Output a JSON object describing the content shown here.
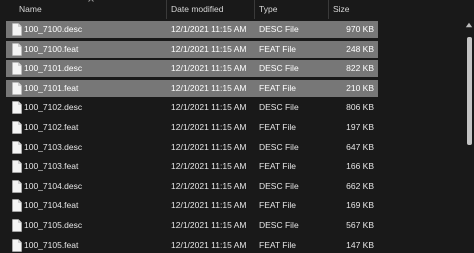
{
  "columns": {
    "name": "Name",
    "date": "Date modified",
    "type": "Type",
    "size": "Size"
  },
  "files": [
    {
      "name": "100_7100.desc",
      "date": "12/1/2021 11:15 AM",
      "type": "DESC File",
      "size": "970 KB",
      "selected": true
    },
    {
      "name": "100_7100.feat",
      "date": "12/1/2021 11:15 AM",
      "type": "FEAT File",
      "size": "248 KB",
      "selected": true
    },
    {
      "name": "100_7101.desc",
      "date": "12/1/2021 11:15 AM",
      "type": "DESC File",
      "size": "822 KB",
      "selected": true
    },
    {
      "name": "100_7101.feat",
      "date": "12/1/2021 11:15 AM",
      "type": "FEAT File",
      "size": "210 KB",
      "selected": true
    },
    {
      "name": "100_7102.desc",
      "date": "12/1/2021 11:15 AM",
      "type": "DESC File",
      "size": "806 KB",
      "selected": false
    },
    {
      "name": "100_7102.feat",
      "date": "12/1/2021 11:15 AM",
      "type": "FEAT File",
      "size": "197 KB",
      "selected": false
    },
    {
      "name": "100_7103.desc",
      "date": "12/1/2021 11:15 AM",
      "type": "DESC File",
      "size": "647 KB",
      "selected": false
    },
    {
      "name": "100_7103.feat",
      "date": "12/1/2021 11:15 AM",
      "type": "FEAT File",
      "size": "166 KB",
      "selected": false
    },
    {
      "name": "100_7104.desc",
      "date": "12/1/2021 11:15 AM",
      "type": "DESC File",
      "size": "662 KB",
      "selected": false
    },
    {
      "name": "100_7104.feat",
      "date": "12/1/2021 11:15 AM",
      "type": "FEAT File",
      "size": "169 KB",
      "selected": false
    },
    {
      "name": "100_7105.desc",
      "date": "12/1/2021 11:15 AM",
      "type": "DESC File",
      "size": "567 KB",
      "selected": false
    },
    {
      "name": "100_7105.feat",
      "date": "12/1/2021 11:15 AM",
      "type": "FEAT File",
      "size": "147 KB",
      "selected": false
    }
  ],
  "colors": {
    "background": "#191919",
    "selection": "#777777",
    "text": "#e6e6e6",
    "scroll_thumb": "#c4c4c4"
  },
  "icons": {
    "file": "file-icon",
    "sort": "sort-caret-icon",
    "scroll_up": "scroll-up-arrow-icon"
  }
}
